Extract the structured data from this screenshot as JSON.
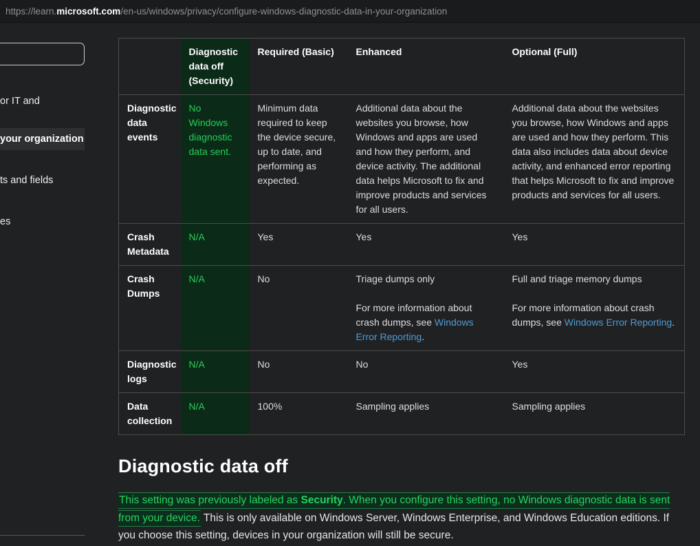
{
  "browser": {
    "url_prefix": "https://learn.",
    "url_domain": "microsoft.com",
    "url_path": "/en-us/windows/privacy/configure-windows-diagnostic-data-in-your-organization"
  },
  "sidebar": {
    "fragment_1": "or IT and",
    "active_item": "your organization",
    "fragment_2": "ts and fields",
    "fragment_3": "es"
  },
  "table": {
    "col_headers": {
      "empty": "",
      "security": "Diagnostic data off (Security)",
      "basic": "Required (Basic)",
      "enhanced": "Enhanced",
      "full": "Optional (Full)"
    },
    "rows": {
      "events": {
        "label": "Diagnostic data events",
        "security": "No Windows diagnostic data sent.",
        "basic": "Minimum data required to keep the device secure, up to date, and performing as expected.",
        "enhanced": "Additional data about the websites you browse, how Windows and apps are used and how they perform, and device activity. The additional data helps Microsoft to fix and improve products and services for all users.",
        "full": "Additional data about the websites you browse, how Windows and apps are used and how they perform. This data also includes data about device activity, and enhanced error reporting that helps Microsoft to fix and improve products and services for all users."
      },
      "crash_metadata": {
        "label": "Crash Metadata",
        "security": "N/A",
        "basic": "Yes",
        "enhanced": "Yes",
        "full": "Yes"
      },
      "crash_dumps": {
        "label": "Crash Dumps",
        "security": "N/A",
        "basic": "No",
        "enhanced_line1": "Triage dumps only",
        "enhanced_more_pre": "For more information about crash dumps, see ",
        "enhanced_link": "Windows Error Reporting",
        "enhanced_more_post": ".",
        "full_line1": "Full and triage memory dumps",
        "full_more_pre": "For more information about crash dumps, see ",
        "full_link": "Windows Error Reporting",
        "full_more_post": "."
      },
      "diagnostic_logs": {
        "label": "Diagnostic logs",
        "security": "N/A",
        "basic": "No",
        "enhanced": "No",
        "full": "Yes"
      },
      "data_collection": {
        "label": "Data collection",
        "security": "N/A",
        "basic": "100%",
        "enhanced": "Sampling applies",
        "full": "Sampling applies"
      }
    }
  },
  "section": {
    "heading": "Diagnostic data off",
    "highlight_part1": "This setting was previously labeled as ",
    "highlight_bold": "Security",
    "highlight_part2": ". When you configure this setting, no Windows diagnostic data is sent from your device.",
    "rest": " This is only available on Windows Server, Windows Enterprise, and Windows Education editions. If you choose this setting, devices in your organization will still be secure."
  },
  "colors": {
    "accent_green_text": "#24d158",
    "accent_green_bg": "#0b2a18",
    "link_blue": "#4f9cd5",
    "highlight_border": "#2a7d4a",
    "page_bg": "#202123"
  }
}
